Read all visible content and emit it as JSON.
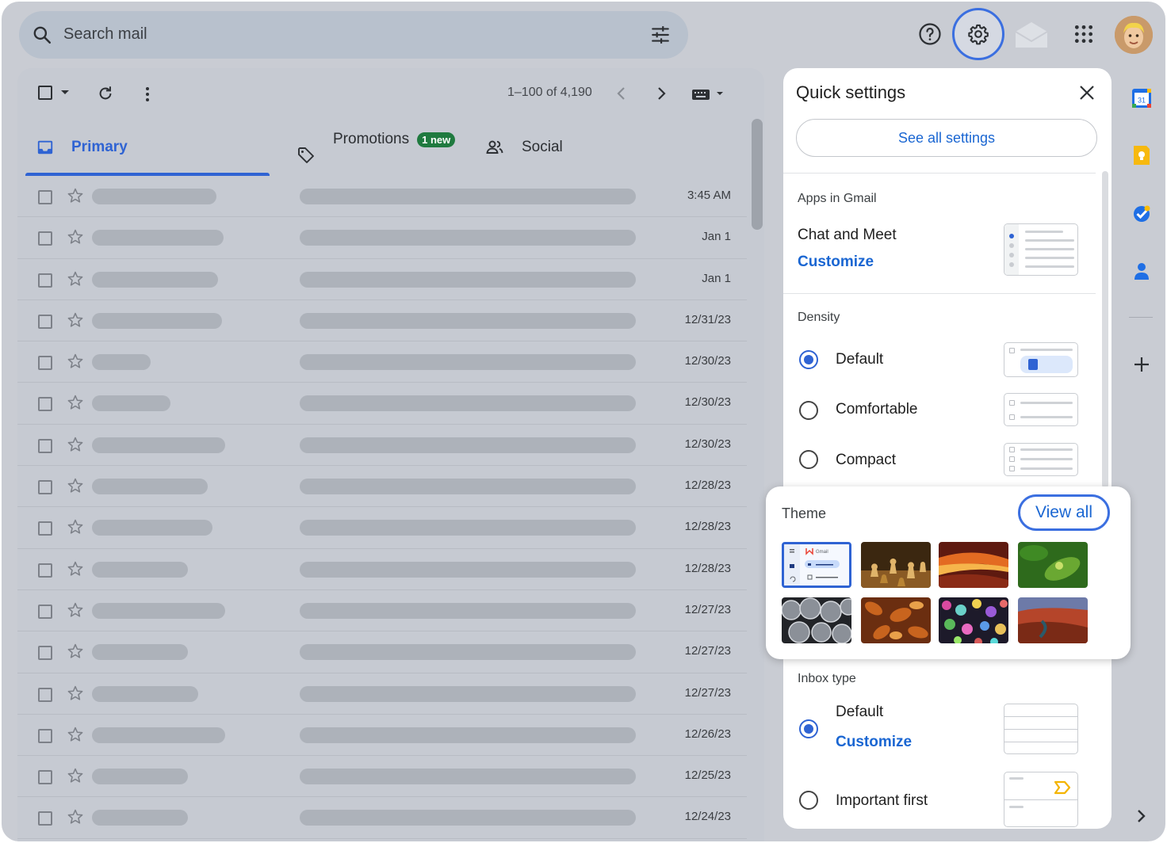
{
  "search": {
    "placeholder": "Search mail"
  },
  "toolbar": {
    "range": "1–100 of 4,190"
  },
  "tabs": [
    {
      "label": "Primary"
    },
    {
      "label": "Promotions",
      "badge": "1 new"
    },
    {
      "label": "Social"
    }
  ],
  "rows": [
    {
      "date": "3:45 AM",
      "sender_fraction": 0.7
    },
    {
      "date": "Jan 1",
      "sender_fraction": 0.74
    },
    {
      "date": "Jan 1",
      "sender_fraction": 0.71
    },
    {
      "date": "12/31/23",
      "sender_fraction": 0.73
    },
    {
      "date": "12/30/23",
      "sender_fraction": 0.33
    },
    {
      "date": "12/30/23",
      "sender_fraction": 0.44
    },
    {
      "date": "12/30/23",
      "sender_fraction": 0.75
    },
    {
      "date": "12/28/23",
      "sender_fraction": 0.65
    },
    {
      "date": "12/28/23",
      "sender_fraction": 0.68
    },
    {
      "date": "12/28/23",
      "sender_fraction": 0.54
    },
    {
      "date": "12/27/23",
      "sender_fraction": 0.75
    },
    {
      "date": "12/27/23",
      "sender_fraction": 0.54
    },
    {
      "date": "12/27/23",
      "sender_fraction": 0.6
    },
    {
      "date": "12/26/23",
      "sender_fraction": 0.75
    },
    {
      "date": "12/25/23",
      "sender_fraction": 0.54
    },
    {
      "date": "12/24/23",
      "sender_fraction": 0.54
    }
  ],
  "quick_settings": {
    "title": "Quick settings",
    "see_all": "See all settings",
    "apps": {
      "title": "Apps in Gmail",
      "item": "Chat and Meet",
      "customize": "Customize"
    },
    "density": {
      "title": "Density",
      "options": [
        {
          "label": "Default",
          "selected": true
        },
        {
          "label": "Comfortable",
          "selected": false
        },
        {
          "label": "Compact",
          "selected": false
        }
      ]
    },
    "theme": {
      "title": "Theme",
      "view_all": "View all",
      "mini_logo": "Gmail"
    },
    "inbox_type": {
      "title": "Inbox type",
      "default_label": "Default",
      "customize": "Customize",
      "important_first": "Important first"
    }
  },
  "rail": {
    "calendar_day": "31"
  },
  "colors": {
    "accent": "#2f63d3",
    "link": "#1a66d2",
    "badge": "#1f7a3f",
    "highlight_ring": "#3b6fe0"
  }
}
